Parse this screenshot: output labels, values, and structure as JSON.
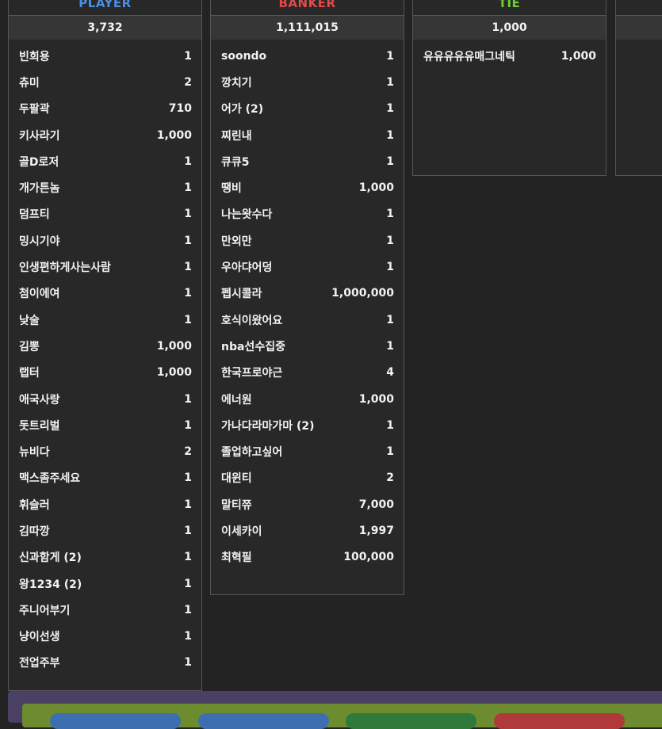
{
  "panels": {
    "player": {
      "title": "PLAYER",
      "title_color": "#4a90e2",
      "total": "3,732",
      "rows": [
        {
          "name": "빈희용",
          "amount": "1"
        },
        {
          "name": "츄미",
          "amount": "2"
        },
        {
          "name": "두팔곽",
          "amount": "710"
        },
        {
          "name": "키사라기",
          "amount": "1,000"
        },
        {
          "name": "골D로저",
          "amount": "1"
        },
        {
          "name": "개가튼놈",
          "amount": "1"
        },
        {
          "name": "덤프티",
          "amount": "1"
        },
        {
          "name": "밍시기야",
          "amount": "1"
        },
        {
          "name": "인생편하게사는사람",
          "amount": "1"
        },
        {
          "name": "첨이에여",
          "amount": "1"
        },
        {
          "name": "낮술",
          "amount": "1"
        },
        {
          "name": "김뽕",
          "amount": "1,000"
        },
        {
          "name": "랩터",
          "amount": "1,000"
        },
        {
          "name": "애국사랑",
          "amount": "1"
        },
        {
          "name": "돗트리벌",
          "amount": "1"
        },
        {
          "name": "뉴비다",
          "amount": "2"
        },
        {
          "name": "맥스좀주세요",
          "amount": "1"
        },
        {
          "name": "휘슬러",
          "amount": "1"
        },
        {
          "name": "김따깡",
          "amount": "1"
        },
        {
          "name": "신과함게 (2)",
          "amount": "1"
        },
        {
          "name": "왕1234 (2)",
          "amount": "1"
        },
        {
          "name": "주니어부기",
          "amount": "1"
        },
        {
          "name": "냥이선생",
          "amount": "1"
        },
        {
          "name": "전업주부",
          "amount": "1"
        }
      ]
    },
    "banker": {
      "title": "BANKER",
      "title_color": "#e24a4a",
      "total": "1,111,015",
      "rows": [
        {
          "name": "soondo",
          "amount": "1"
        },
        {
          "name": "깡치기",
          "amount": "1"
        },
        {
          "name": "어가 (2)",
          "amount": "1"
        },
        {
          "name": "찌린내",
          "amount": "1"
        },
        {
          "name": "큐큐5",
          "amount": "1"
        },
        {
          "name": "땡비",
          "amount": "1,000"
        },
        {
          "name": "나는왓수다",
          "amount": "1"
        },
        {
          "name": "만외만",
          "amount": "1"
        },
        {
          "name": "우아댜어덩",
          "amount": "1"
        },
        {
          "name": "펩시콜라",
          "amount": "1,000,000"
        },
        {
          "name": "호식이왔어요",
          "amount": "1"
        },
        {
          "name": "nba선수집중",
          "amount": "1"
        },
        {
          "name": "한국프로야근",
          "amount": "4"
        },
        {
          "name": "에너원",
          "amount": "1,000"
        },
        {
          "name": "가나다라마가마 (2)",
          "amount": "1"
        },
        {
          "name": "졸업하고싶어",
          "amount": "1"
        },
        {
          "name": "대윈티",
          "amount": "2"
        },
        {
          "name": "말티쮸",
          "amount": "7,000"
        },
        {
          "name": "이세카이",
          "amount": "1,997"
        },
        {
          "name": "최혁필",
          "amount": "100,000"
        }
      ]
    },
    "tie": {
      "title": "TIE",
      "title_color": "#6fcf3a",
      "total": "1,000",
      "rows": [
        {
          "name": "유유유유유매그네틱",
          "amount": "1,000"
        }
      ]
    }
  },
  "bottom_chips": [
    {
      "color": "#3d6fb0"
    },
    {
      "color": "#3d6fb0"
    },
    {
      "color": "#2f7a3a"
    },
    {
      "color": "#b03a3a"
    }
  ]
}
